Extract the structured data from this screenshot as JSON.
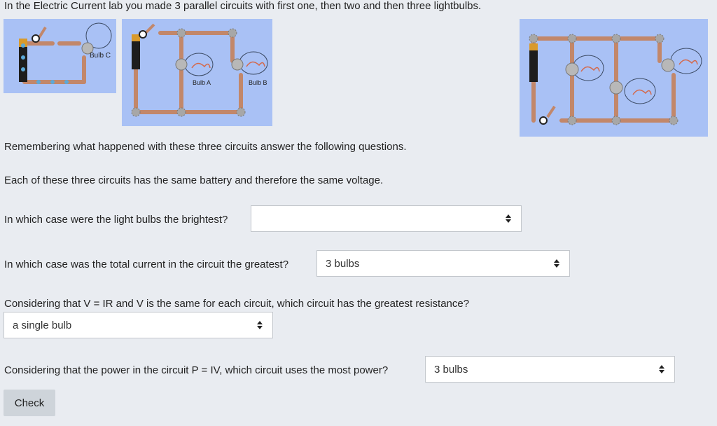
{
  "intro": "In the Electric Current lab you made 3 parallel circuits with first one, then two and then three lightbulbs.",
  "figures": {
    "circuit1": {
      "bulb_label": "Bulb C"
    },
    "circuit2": {
      "bulb_a_label": "Bulb A",
      "bulb_b_label": "Bulb B"
    },
    "colors": {
      "panel": "#a9c1f5",
      "wire": "#c2876a",
      "joint": "#a7a7a7"
    }
  },
  "remember_text": "Remembering what happened with these three circuits answer the following questions.",
  "voltage_text": "Each of these three circuits has the same battery and therefore the same voltage.",
  "questions": [
    {
      "text": "In which case were the light bulbs the brightest?",
      "value": ""
    },
    {
      "text": "In which case was the total current in the circuit the greatest?",
      "value": "3 bulbs"
    },
    {
      "text": "Considering that V = IR and V is the same for each circuit, which circuit has the greatest resistance?",
      "value": "a single bulb"
    },
    {
      "text": "Considering that the power in the circuit P = IV, which circuit uses the most power?",
      "value": "3 bulbs"
    }
  ],
  "check_label": "Check",
  "icons": {
    "select": "up-down-arrows-icon"
  }
}
